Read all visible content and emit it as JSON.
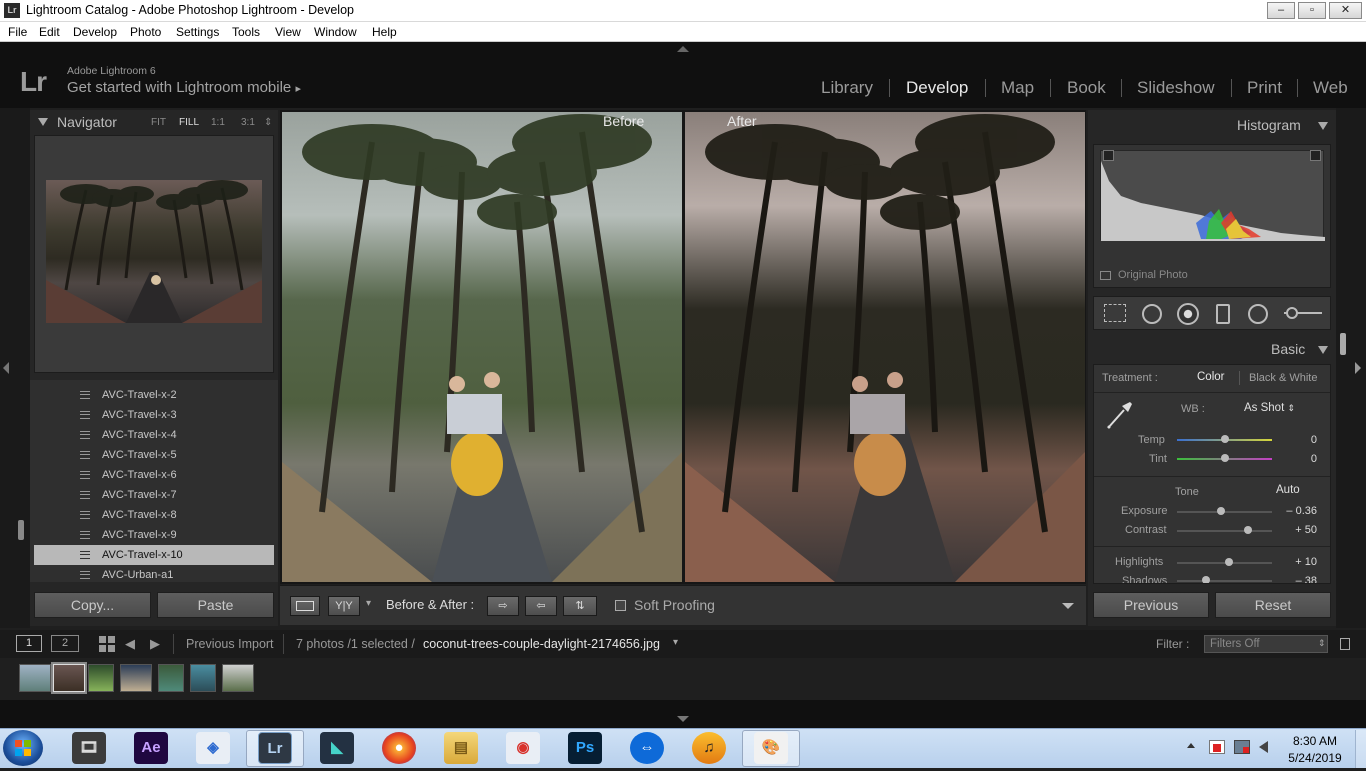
{
  "window": {
    "title": "Lightroom Catalog - Adobe Photoshop Lightroom - Develop",
    "app_badge": "Lr",
    "minimize_glyph": "–",
    "maximize_glyph": "▫",
    "close_glyph": "✕"
  },
  "menu": [
    "File",
    "Edit",
    "Develop",
    "Photo",
    "Settings",
    "Tools",
    "View",
    "Window",
    "Help"
  ],
  "identity": {
    "logo": "Lr",
    "version": "Adobe Lightroom 6",
    "mobile_prompt": "Get started with Lightroom mobile",
    "mobile_arrow": "▸"
  },
  "modules": [
    "Library",
    "Develop",
    "Map",
    "Book",
    "Slideshow",
    "Print",
    "Web"
  ],
  "active_module": "Develop",
  "navigator": {
    "title": "Navigator",
    "zoom_options": [
      "FIT",
      "FILL",
      "1:1",
      "3:1"
    ],
    "zoom_more": "⇕",
    "selected_zoom": "FILL"
  },
  "presets": [
    "AVC-Travel-x-2",
    "AVC-Travel-x-3",
    "AVC-Travel-x-4",
    "AVC-Travel-x-5",
    "AVC-Travel-x-6",
    "AVC-Travel-x-7",
    "AVC-Travel-x-8",
    "AVC-Travel-x-9",
    "AVC-Travel-x-10",
    "AVC-Urban-a1"
  ],
  "selected_preset": "AVC-Travel-x-10",
  "left_buttons": {
    "copy": "Copy...",
    "paste": "Paste"
  },
  "view": {
    "before_caption": "Before",
    "after_caption": "After"
  },
  "toolbar": {
    "yy_label": "Y|Y",
    "dropdown_arrow": "▾",
    "before_after_label": "Before & After :",
    "copy_after_to_before": "⇨",
    "copy_before_to_after": "⇦",
    "swap": "⇅",
    "soft_proofing": "Soft Proofing"
  },
  "histogram": {
    "title": "Histogram",
    "original_photo": "Original Photo"
  },
  "basic": {
    "title": "Basic",
    "treatment_label": "Treatment :",
    "treatment_color": "Color",
    "treatment_bw": "Black & White",
    "wb_label": "WB :",
    "wb_value": "As Shot",
    "wb_arrows": "⇕",
    "temp_label": "Temp",
    "temp_value": "0",
    "temp_level": 0.5,
    "tint_label": "Tint",
    "tint_value": "0",
    "tint_level": 0.5,
    "tone_label": "Tone",
    "auto_label": "Auto",
    "exposure_label": "Exposure",
    "exposure_value": "– 0.36",
    "exposure_level": 0.46,
    "contrast_label": "Contrast",
    "contrast_value": "+ 50",
    "contrast_level": 0.75,
    "highlights_label": "Highlights",
    "highlights_value": "+ 10",
    "highlights_level": 0.55,
    "shadows_label": "Shadows",
    "shadows_value": "– 38",
    "shadows_level": 0.31
  },
  "right_buttons": {
    "previous": "Previous",
    "reset": "Reset"
  },
  "filmbar": {
    "screen1": "1",
    "screen2": "2",
    "prev_arrow": "◀",
    "next_arrow": "▶",
    "source": "Previous Import",
    "count": "7 photos /1 selected /",
    "filename": "coconut-trees-couple-daylight-2174656.jpg",
    "filename_arrow": "▾",
    "filter_label": "Filter :",
    "filter_value": "Filters Off",
    "filter_arrows": "⇕"
  },
  "taskbar": {
    "icons": [
      {
        "name": "media-player",
        "glyph": "🎞"
      },
      {
        "name": "after-effects",
        "glyph": "Ae"
      },
      {
        "name": "sketchup",
        "glyph": "◈"
      },
      {
        "name": "lightroom",
        "glyph": "Lr"
      },
      {
        "name": "filmora",
        "glyph": "◣"
      },
      {
        "name": "firefox",
        "glyph": "●"
      },
      {
        "name": "file-explorer",
        "glyph": "▤"
      },
      {
        "name": "camtasia",
        "glyph": "◉"
      },
      {
        "name": "photoshop",
        "glyph": "Ps"
      },
      {
        "name": "teamviewer",
        "glyph": "⇔"
      },
      {
        "name": "audacity",
        "glyph": "♫"
      },
      {
        "name": "paint",
        "glyph": "🎨"
      }
    ],
    "time": "8:30 AM",
    "date": "5/24/2019"
  },
  "colors": {
    "accent_light": "#e8e8e8",
    "panel": "#2b2b2b",
    "selected_preset_bg": "#b8b8b8"
  }
}
